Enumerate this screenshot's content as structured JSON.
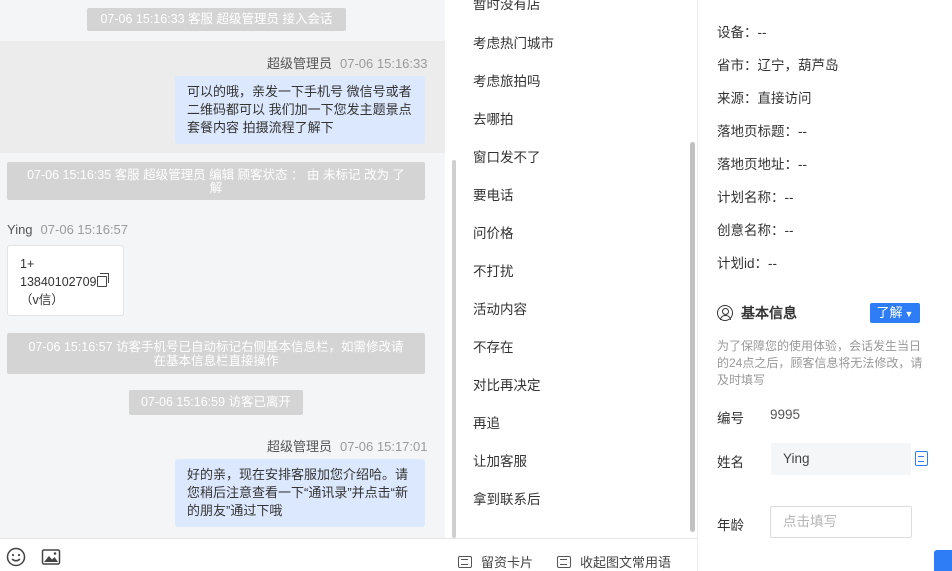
{
  "chat": {
    "sys1": "07-06 15:16:33 客服 超级管理员 接入会话",
    "msg1": {
      "sender": "超级管理员",
      "time": "07-06 15:16:33",
      "lines": [
        "可以的哦，亲发一下手机号 微信号或者",
        "二维码都可以 我们加一下您发主题景点",
        "套餐内容 拍摄流程了解下"
      ]
    },
    "sys2": {
      "lines": [
        "07-06 15:16:35 客服 超级管理员 编辑 顾客状态 ： 由 未标记 改为 了",
        "解"
      ]
    },
    "msg2": {
      "sender": "Ying",
      "time": "07-06 15:16:57",
      "card_lines": [
        "1+",
        "13840102709",
        "（v信）"
      ]
    },
    "sys3": {
      "lines": [
        "07-06 15:16:57 访客手机号已自动标记右侧基本信息栏，如需修改请",
        "在基本信息栏直接操作"
      ]
    },
    "sys4": "07-06 15:16:59 访客已离开",
    "msg3": {
      "sender": "超级管理员",
      "time": "07-06 15:17:01",
      "lines": [
        "好的亲，现在安排客服加您介绍哈。请",
        "您稍后注意查看一下“通讯录”并点击“新",
        "的朋友”通过下哦"
      ]
    }
  },
  "phrases": {
    "items": [
      "暂时没有店",
      "考虑热门城市",
      "考虑旅拍吗",
      "去哪拍",
      "窗口发不了",
      "要电话",
      "问价格",
      "不打扰",
      "活动内容",
      "不存在",
      "对比再决定",
      "再追",
      "让加客服",
      "拿到联系后"
    ],
    "footer_card": "留资卡片",
    "footer_fold": "收起图文常用语"
  },
  "info": {
    "device": "设备：--",
    "province": "省市：辽宁，葫芦岛",
    "source": "来源：直接访问",
    "landing_title": "落地页标题：--",
    "landing_url": "落地页地址：--",
    "plan_name": "计划名称：--",
    "creative_name": "创意名称：--",
    "plan_id": "计划id：--",
    "section_title": "基本信息",
    "learn_button": "了解",
    "note": "为了保障您的使用体验，会话发生当日的24点之后，顾客信息将无法修改，请及时填写",
    "number_label": "编号",
    "number_value": "9995",
    "name_label": "姓名",
    "name_value": "Ying",
    "age_label": "年龄",
    "age_placeholder": "点击填写"
  }
}
